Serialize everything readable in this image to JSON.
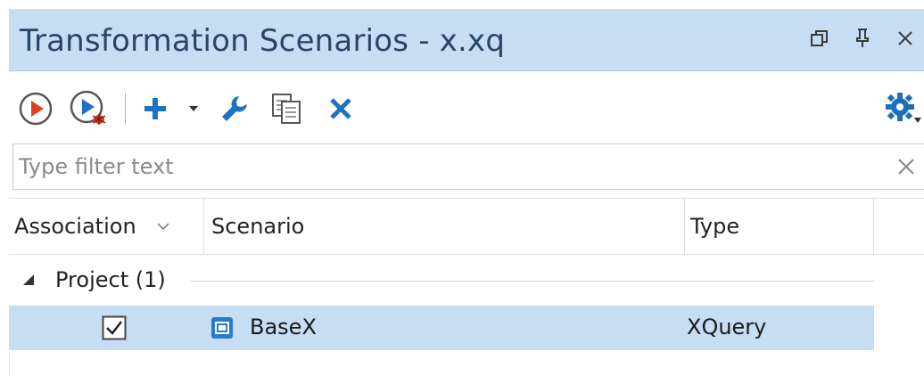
{
  "window": {
    "title": "Transformation Scenarios - x.xq",
    "controls": [
      "restore-icon",
      "pin-icon",
      "close-icon"
    ]
  },
  "toolbar": {
    "buttons": [
      {
        "name": "apply-scenario",
        "icon": "run-icon"
      },
      {
        "name": "debug-scenario",
        "icon": "debug-run-icon"
      },
      {
        "name": "new-scenario",
        "icon": "plus-icon"
      },
      {
        "name": "new-dropdown",
        "icon": "dropdown-arrow-icon"
      },
      {
        "name": "edit-scenario",
        "icon": "wrench-icon"
      },
      {
        "name": "duplicate-scenario",
        "icon": "duplicate-icon"
      },
      {
        "name": "remove-scenario",
        "icon": "delete-x-icon"
      },
      {
        "name": "settings",
        "icon": "gear-icon"
      }
    ]
  },
  "filter": {
    "placeholder": "Type filter text",
    "value": ""
  },
  "table": {
    "columns": [
      "Association",
      "Scenario",
      "Type"
    ],
    "sorted_column": "Association",
    "groups": [
      {
        "label": "Project (1)",
        "expanded": true,
        "rows": [
          {
            "associated": true,
            "scenario": "BaseX",
            "type": "XQuery",
            "selected": true
          }
        ]
      }
    ]
  },
  "colors": {
    "titlebar": "#c7ddf3",
    "title_text": "#28466a",
    "selection": "#c7ddf3",
    "run_red": "#e0401c",
    "toolbar_blue": "#1e73be"
  }
}
